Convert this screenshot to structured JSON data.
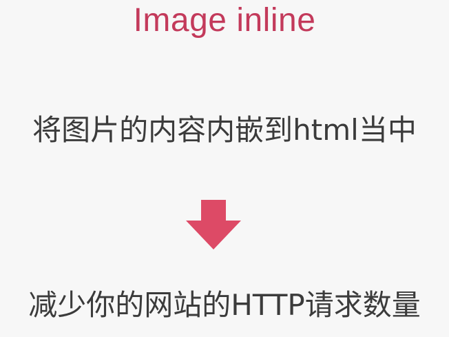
{
  "slide": {
    "title": "Image inline",
    "description": "将图片的内容内嵌到html当中",
    "result": "减少你的网站的HTTP请求数量",
    "arrow_icon": "down-arrow-icon",
    "colors": {
      "title": "#c33a5b",
      "arrow": "#dd4a66",
      "text": "#3b3b3b",
      "background": "#f7f7f7"
    }
  }
}
